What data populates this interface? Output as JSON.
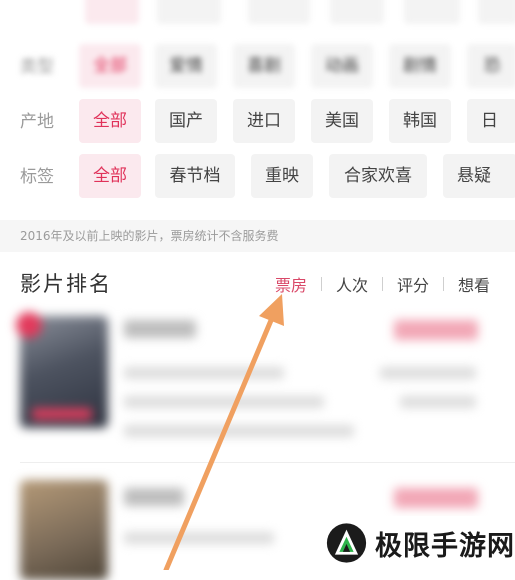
{
  "filters": {
    "top_row_chips": [
      "",
      "",
      "",
      "",
      "",
      ""
    ],
    "type": {
      "label": "类型",
      "options": [
        "全部",
        "爱情",
        "喜剧",
        "动画",
        "剧情",
        "恐"
      ]
    },
    "region": {
      "label": "产地",
      "options": [
        "全部",
        "国产",
        "进口",
        "美国",
        "韩国",
        "日"
      ]
    },
    "tags": {
      "label": "标签",
      "options": [
        "全部",
        "春节档",
        "重映",
        "合家欢喜",
        "悬疑"
      ]
    }
  },
  "notice": "2016年及以前上映的影片，票房统计不含服务费",
  "ranking": {
    "title": "影片排名",
    "sort_tabs": [
      "票房",
      "人次",
      "评分",
      "想看"
    ],
    "active_tab": "票房"
  },
  "colors": {
    "accent": "#e0325a",
    "arrow": "#f0a060"
  },
  "watermark": {
    "text": "极限手游网",
    "logo": "mountain-logo-icon"
  }
}
